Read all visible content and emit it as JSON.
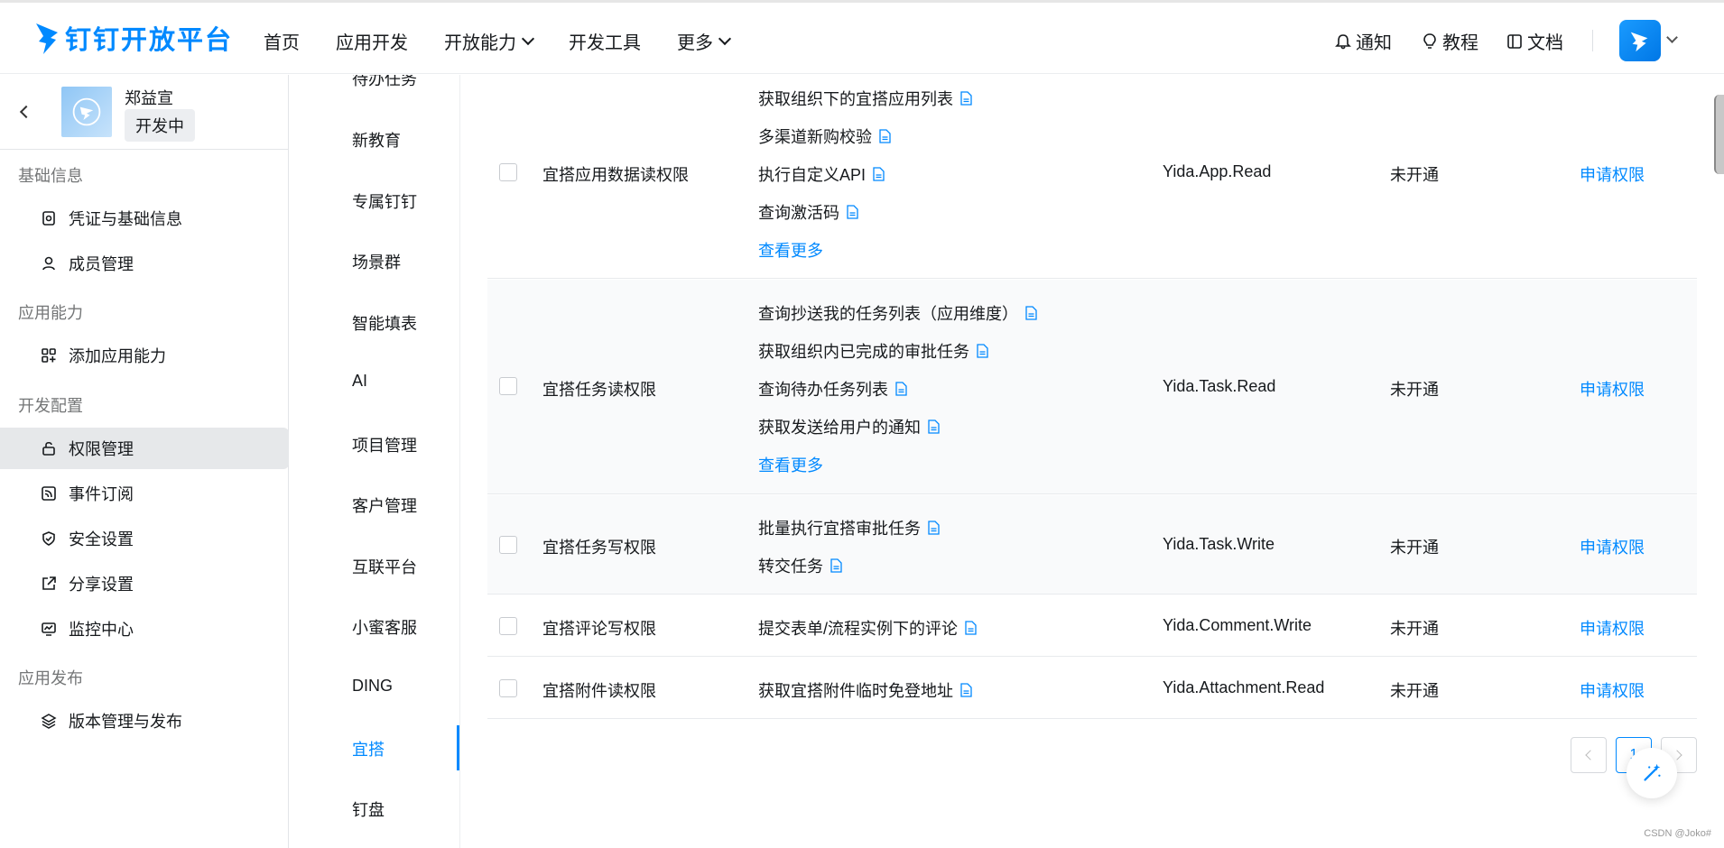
{
  "header": {
    "logo_text": "钉钉开放平台",
    "nav": [
      "首页",
      "应用开发",
      "开放能力",
      "开发工具",
      "更多"
    ],
    "links": {
      "notify": "通知",
      "tutorial": "教程",
      "docs": "文档"
    }
  },
  "app": {
    "name": "郑益宣",
    "status": "开发中"
  },
  "sidebar": {
    "groups": [
      "基础信息",
      "应用能力",
      "开发配置",
      "应用发布"
    ],
    "items": [
      "凭证与基础信息",
      "成员管理",
      "添加应用能力",
      "权限管理",
      "事件订阅",
      "安全设置",
      "分享设置",
      "监控中心",
      "版本管理与发布"
    ]
  },
  "subnav": [
    "待办任务",
    "新教育",
    "专属钉钉",
    "场景群",
    "智能填表",
    "AI",
    "项目管理",
    "客户管理",
    "互联平台",
    "小蜜客服",
    "DING",
    "宜搭",
    "钉盘"
  ],
  "table": {
    "rows": [
      {
        "name": "宜搭应用数据读权限",
        "apis": [
          "获取组织下的宜搭应用列表",
          "多渠道新购校验",
          "执行自定义API",
          "查询激活码"
        ],
        "more": "查看更多",
        "scope": "Yida.App.Read",
        "status": "未开通",
        "action": "申请权限"
      },
      {
        "name": "宜搭任务读权限",
        "apis": [
          "查询抄送我的任务列表（应用维度）",
          "获取组织内已完成的审批任务",
          "查询待办任务列表",
          "获取发送给用户的通知"
        ],
        "more": "查看更多",
        "scope": "Yida.Task.Read",
        "status": "未开通",
        "action": "申请权限"
      },
      {
        "name": "宜搭任务写权限",
        "apis": [
          "批量执行宜搭审批任务",
          "转交任务"
        ],
        "scope": "Yida.Task.Write",
        "status": "未开通",
        "action": "申请权限"
      },
      {
        "name": "宜搭评论写权限",
        "apis": [
          "提交表单/流程实例下的评论"
        ],
        "scope": "Yida.Comment.Write",
        "status": "未开通",
        "action": "申请权限"
      },
      {
        "name": "宜搭附件读权限",
        "apis": [
          "获取宜搭附件临时免登地址"
        ],
        "scope": "Yida.Attachment.Read",
        "status": "未开通",
        "action": "申请权限"
      }
    ]
  },
  "pagination": {
    "current": "1"
  },
  "watermark": "CSDN @Joko#",
  "colors": {
    "primary": "#0089ff",
    "active_bg": "#e6e8ea"
  }
}
